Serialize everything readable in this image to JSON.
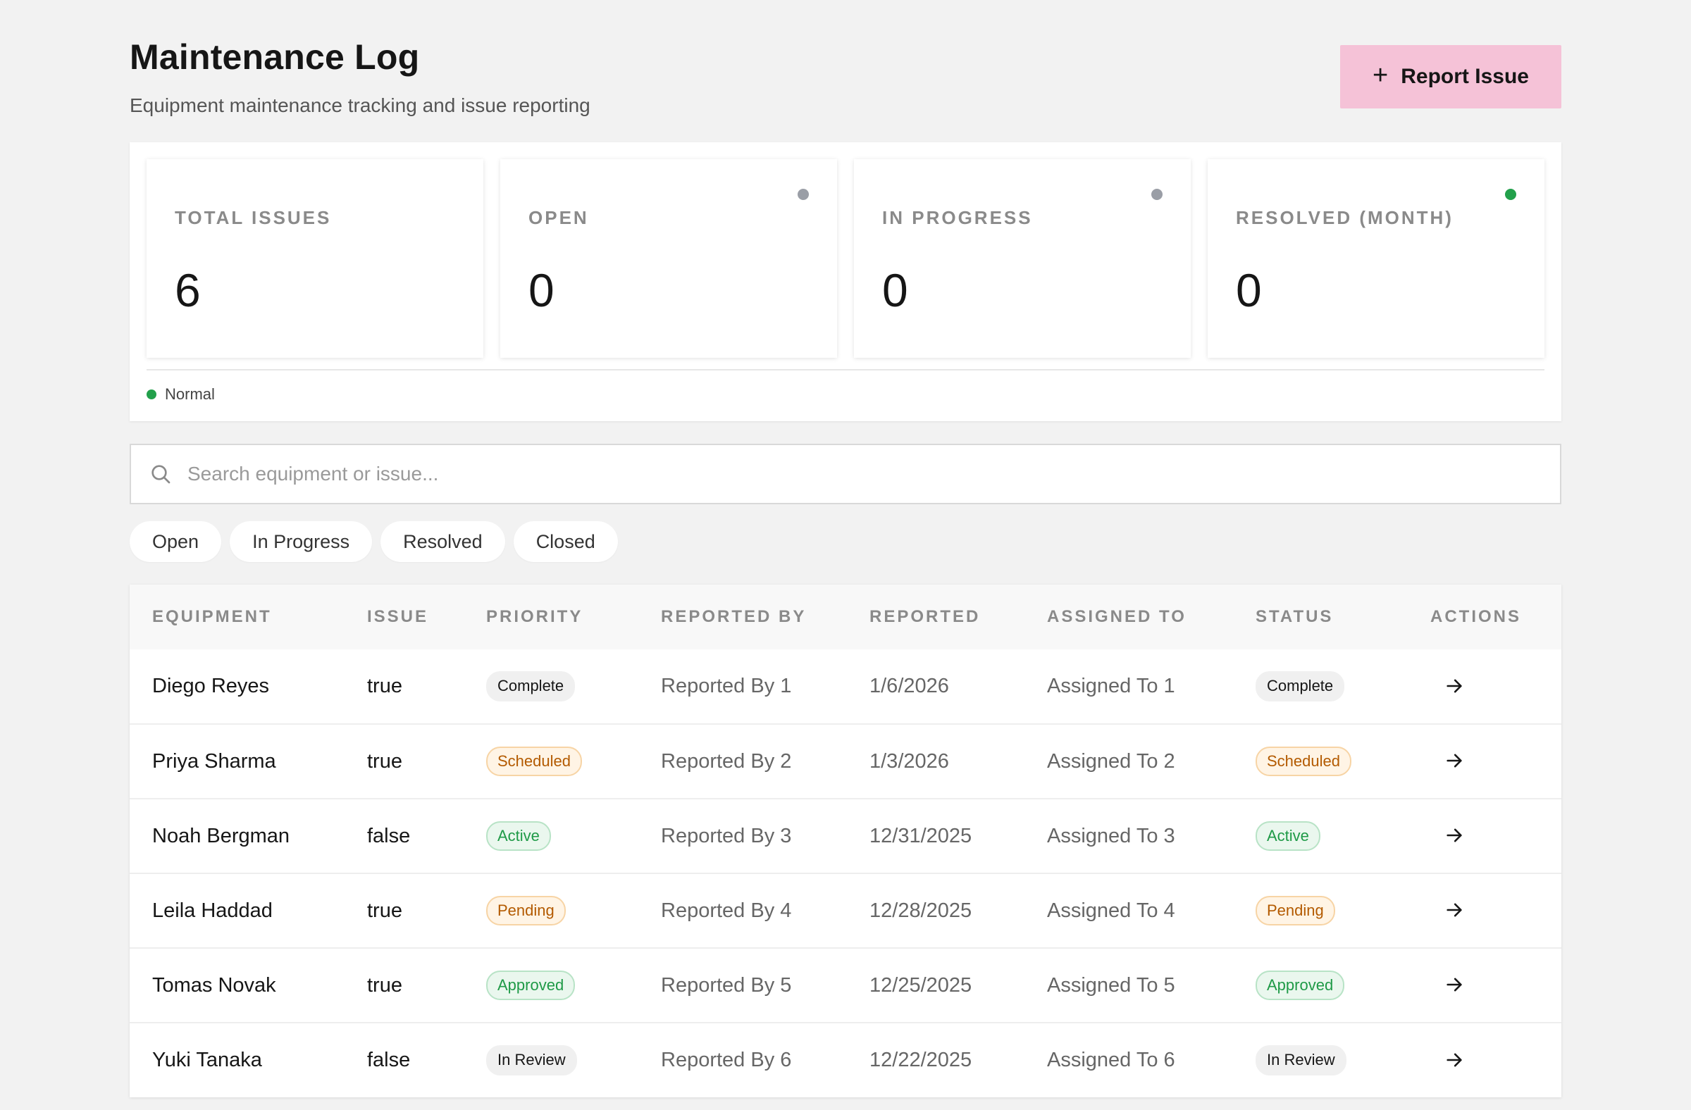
{
  "header": {
    "title": "Maintenance Log",
    "subtitle": "Equipment maintenance tracking and issue reporting",
    "report_button": "Report Issue",
    "report_button_icon": "plus-icon",
    "accent_color": "#f5c2d7"
  },
  "stats": [
    {
      "label": "TOTAL ISSUES",
      "value": "6",
      "dot_color": null
    },
    {
      "label": "OPEN",
      "value": "0",
      "dot_color": "#9a9ea6"
    },
    {
      "label": "IN PROGRESS",
      "value": "0",
      "dot_color": "#9a9ea6"
    },
    {
      "label": "RESOLVED (MONTH)",
      "value": "0",
      "dot_color": "#22a04b"
    }
  ],
  "legend": {
    "label": "Normal",
    "color": "#22a04b"
  },
  "search": {
    "placeholder": "Search equipment or issue..."
  },
  "filters": [
    "Open",
    "In Progress",
    "Resolved",
    "Closed"
  ],
  "table": {
    "columns": [
      "EQUIPMENT",
      "ISSUE",
      "PRIORITY",
      "REPORTED BY",
      "REPORTED",
      "ASSIGNED TO",
      "STATUS",
      "ACTIONS"
    ],
    "rows": [
      {
        "equipment": "Diego Reyes",
        "issue": "true",
        "priority": "Complete",
        "reported_by": "Reported By 1",
        "reported": "1/6/2026",
        "assigned_to": "Assigned To 1",
        "status": "Complete",
        "tone": "neutral"
      },
      {
        "equipment": "Priya Sharma",
        "issue": "true",
        "priority": "Scheduled",
        "reported_by": "Reported By 2",
        "reported": "1/3/2026",
        "assigned_to": "Assigned To 2",
        "status": "Scheduled",
        "tone": "orange"
      },
      {
        "equipment": "Noah Bergman",
        "issue": "false",
        "priority": "Active",
        "reported_by": "Reported By 3",
        "reported": "12/31/2025",
        "assigned_to": "Assigned To 3",
        "status": "Active",
        "tone": "green"
      },
      {
        "equipment": "Leila Haddad",
        "issue": "true",
        "priority": "Pending",
        "reported_by": "Reported By 4",
        "reported": "12/28/2025",
        "assigned_to": "Assigned To 4",
        "status": "Pending",
        "tone": "orange"
      },
      {
        "equipment": "Tomas Novak",
        "issue": "true",
        "priority": "Approved",
        "reported_by": "Reported By 5",
        "reported": "12/25/2025",
        "assigned_to": "Assigned To 5",
        "status": "Approved",
        "tone": "green"
      },
      {
        "equipment": "Yuki Tanaka",
        "issue": "false",
        "priority": "In Review",
        "reported_by": "Reported By 6",
        "reported": "12/22/2025",
        "assigned_to": "Assigned To 6",
        "status": "In Review",
        "tone": "neutral"
      }
    ]
  }
}
